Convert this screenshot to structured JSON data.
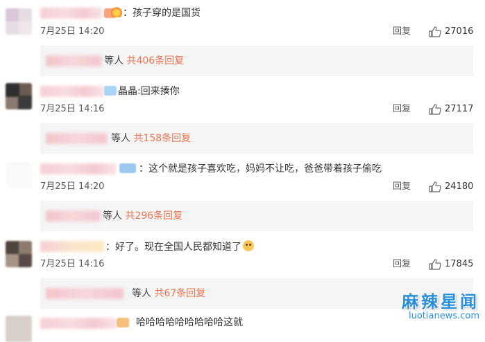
{
  "reply_label": "回复",
  "etc_label": "等人",
  "colors": {
    "accent": "#eb7350",
    "watermark": "#2a8fd8"
  },
  "comments": [
    {
      "text": "：孩子穿的是国货",
      "time": "7月25日 14:20",
      "likes": "27016",
      "reply_count": "共406条回复"
    },
    {
      "text": "晶晶:回来揍你",
      "time": "7月25日 14:16",
      "likes": "27117",
      "reply_count": "共158条回复"
    },
    {
      "text": "：这个就是孩子喜欢吃，妈妈不让吃，爸爸带着孩子偷吃",
      "time": "7月25日 14:20",
      "likes": "24180",
      "reply_count": "共296条回复"
    },
    {
      "text": "：好了。现在全国人民都知道了",
      "time": "7月25日 14:16",
      "likes": "17845",
      "reply_count": "共67条回复"
    },
    {
      "text": "哈哈哈哈哈哈哈哈哈这就"
    }
  ],
  "watermark": {
    "title": "麻辣星闻",
    "url": "luotianews.com"
  }
}
